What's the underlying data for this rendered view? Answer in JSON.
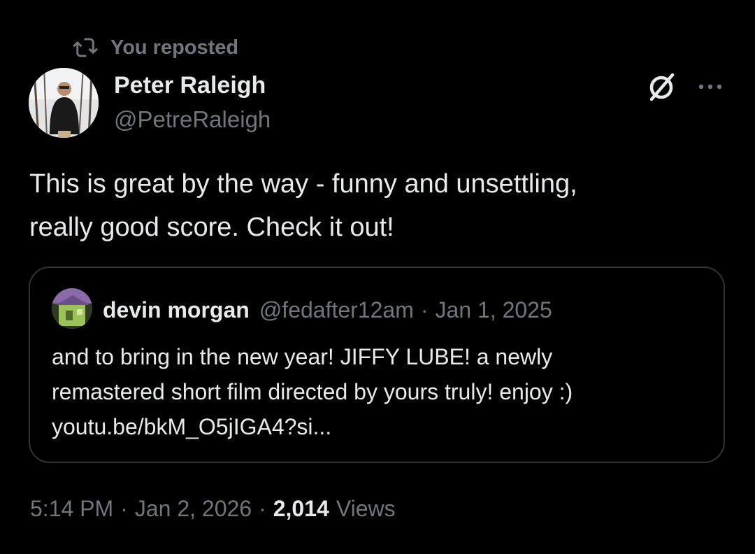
{
  "colors": {
    "background": "#000000",
    "primary_text": "#e7e9ea",
    "secondary_text": "#71767b",
    "border": "#2f3336"
  },
  "repost": {
    "icon": "repost-icon",
    "label": "You reposted"
  },
  "post": {
    "author": {
      "name": "Peter Raleigh",
      "handle": "@PetreRaleigh",
      "avatar_icon": "user-avatar"
    },
    "grok_icon": "grok-icon",
    "more_icon": "more-options-icon",
    "text_line1": "This is great by the way - funny and unsettling,",
    "text_line2": "really good score. Check it out!",
    "quoted": {
      "name": "devin morgan",
      "handle": "@fedafter12am",
      "separator": "·",
      "date": "Jan 1, 2025",
      "line1": "and to bring in the new year! JIFFY LUBE! a newly",
      "line2": "remastered short film directed by yours truly! enjoy :)",
      "line3": "youtu.be/bkM_O5jIGA4?si..."
    },
    "meta": {
      "time": "5:14 PM",
      "separator": "·",
      "date": "Jan 2, 2026",
      "views_count": "2,014",
      "views_label": "Views"
    }
  }
}
